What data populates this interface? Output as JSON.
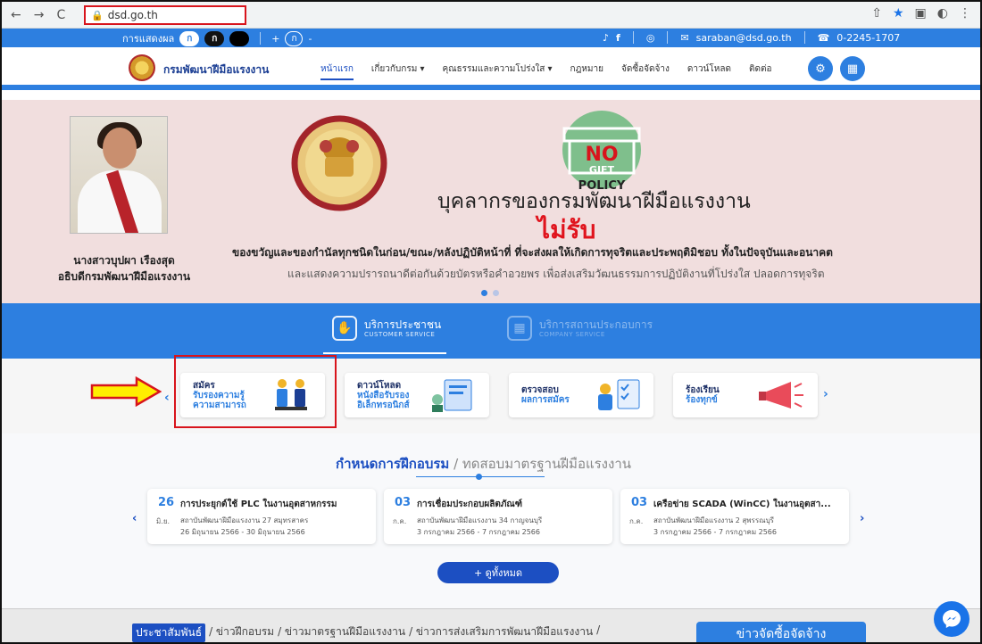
{
  "browser": {
    "url": "dsd.go.th",
    "back": "←",
    "forward": "→",
    "reload": "C"
  },
  "topbar": {
    "display_label": "การแสดงผล",
    "contrast_a": "ก",
    "contrast_b": "ก",
    "font_plus": "+",
    "font_normal": "ก",
    "font_minus": "-",
    "email": "saraban@dsd.go.th",
    "phone": "0-2245-1707"
  },
  "nav": {
    "brand": "กรมพัฒนาฝีมือแรงงาน",
    "items": [
      "หน้าแรก",
      "เกี่ยวกับกรม ▾",
      "คุณธรรมและความโปร่งใส ▾",
      "กฎหมาย",
      "จัดซื้อจัดจ้าง",
      "ดาวน์โหลด",
      "ติดต่อ"
    ]
  },
  "hero": {
    "person_name": "นางสาวบุปผา เรืองสุด",
    "person_title": "อธิบดีกรมพัฒนาฝีมือแรงงาน",
    "badge_no": "NO",
    "badge_gift": "GIFT",
    "badge_policy": "POLICY",
    "title": "บุคลากรของกรมพัฒนาฝีมือแรงงาน",
    "highlight": "ไม่รับ",
    "line1": "ของขวัญและของกำนัลทุกชนิดในก่อน/ขณะ/หลังปฏิบัติหน้าที่ ที่จะส่งผลให้เกิดการทุจริตและประพฤติมิชอบ ทั้งในปัจจุบันและอนาคต",
    "line2": "และแสดงความปรารถนาดีต่อกันด้วยบัตรหรือคำอวยพร เพื่อส่งเสริมวัฒนธรรมการปฏิบัติงานที่โปร่งใส ปลอดการทุจริต"
  },
  "service_tabs": [
    {
      "label": "บริการประชาชน",
      "sub": "CUSTOMER SERVICE"
    },
    {
      "label": "บริการสถานประกอบการ",
      "sub": "COMPANY SERVICE"
    }
  ],
  "cards": [
    {
      "line1": "สมัคร",
      "line2": "รับรองความรู้",
      "line3": "ความสามารถ"
    },
    {
      "line1": "ดาวน์โหลด",
      "line2": "หนังสือรับรอง",
      "line3": "อิเล็กทรอนิกส์"
    },
    {
      "line1": "ตรวจสอบ",
      "line2": "ผลการสมัคร",
      "line3": ""
    },
    {
      "line1": "ร้องเรียน",
      "line2": "ร้องทุกข์",
      "line3": ""
    }
  ],
  "training": {
    "title_active": "กำหนดการฝึกอบรม",
    "title_sep": " / ",
    "title_inactive": "ทดสอบมาตรฐานฝีมือแรงงาน",
    "items": [
      {
        "day": "26",
        "month": "มิ.ย.",
        "name": "การประยุกต์ใช้ PLC ในงานอุตสาหกรรม",
        "place": "สถาบันพัฒนาฝีมือแรงงาน 27 สมุทรสาคร",
        "dates": "26 มิถุนายน 2566 - 30 มิถุนายน 2566"
      },
      {
        "day": "03",
        "month": "ก.ค.",
        "name": "การเชื่อมประกอบผลิตภัณฑ์",
        "place": "สถาบันพัฒนาฝีมือแรงงาน 34 กาญจนบุรี",
        "dates": "3 กรกฎาคม 2566 - 7 กรกฎาคม 2566"
      },
      {
        "day": "03",
        "month": "ก.ค.",
        "name": "เครือข่าย SCADA (WinCC) ในงานอุตสา...",
        "place": "สถาบันพัฒนาฝีมือแรงงาน 2 สุพรรณบุรี",
        "dates": "3 กรกฎาคม 2566 - 7 กรกฎาคม 2566"
      }
    ],
    "view_all": "+ ดูทั้งหมด"
  },
  "news": {
    "tags": [
      "ประชาสัมพันธ์",
      "/ ข่าวฝึกอบรม",
      "/ ข่าวมาตรฐานฝีมือแรงงาน",
      "/ ข่าวการส่งเสริมการพัฒนาฝีมือแรงงาน",
      "/"
    ],
    "procurement": "ข่าวจัดซื้อจัดจ้าง"
  },
  "colors": {
    "primary": "#2d7fe0",
    "navy": "#1c4fc2",
    "highlight_red": "#d8141c",
    "arrow_yellow": "#ffee00"
  }
}
